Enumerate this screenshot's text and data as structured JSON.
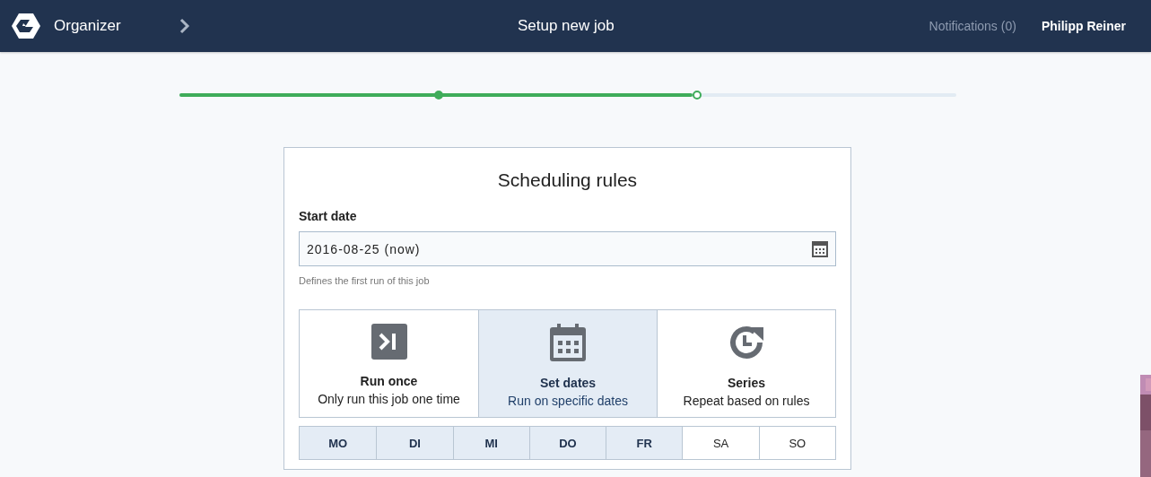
{
  "header": {
    "app_name": "Organizer",
    "page_title": "Setup new job",
    "notifications": "Notifications (0)",
    "user": "Philipp Reiner"
  },
  "progress": {
    "level": 0.66,
    "steps": [
      {
        "filled": true
      },
      {
        "filled": false
      }
    ]
  },
  "card": {
    "title": "Scheduling rules",
    "start_date": {
      "label": "Start date",
      "value": "2016-08-25 (now)",
      "hint": "Defines the first run of this job"
    },
    "modes": [
      {
        "kind": "once",
        "title": "Run once",
        "subtitle": "Only run this job one time",
        "selected": false
      },
      {
        "kind": "dates",
        "title": "Set dates",
        "subtitle": "Run on specific dates",
        "selected": true
      },
      {
        "kind": "series",
        "title": "Series",
        "subtitle": "Repeat based on rules",
        "selected": false
      }
    ],
    "days": [
      {
        "label": "MO",
        "selected": true
      },
      {
        "label": "DI",
        "selected": true
      },
      {
        "label": "MI",
        "selected": true
      },
      {
        "label": "DO",
        "selected": true
      },
      {
        "label": "FR",
        "selected": true
      },
      {
        "label": "SA",
        "selected": false
      },
      {
        "label": "SO",
        "selected": false
      }
    ]
  }
}
